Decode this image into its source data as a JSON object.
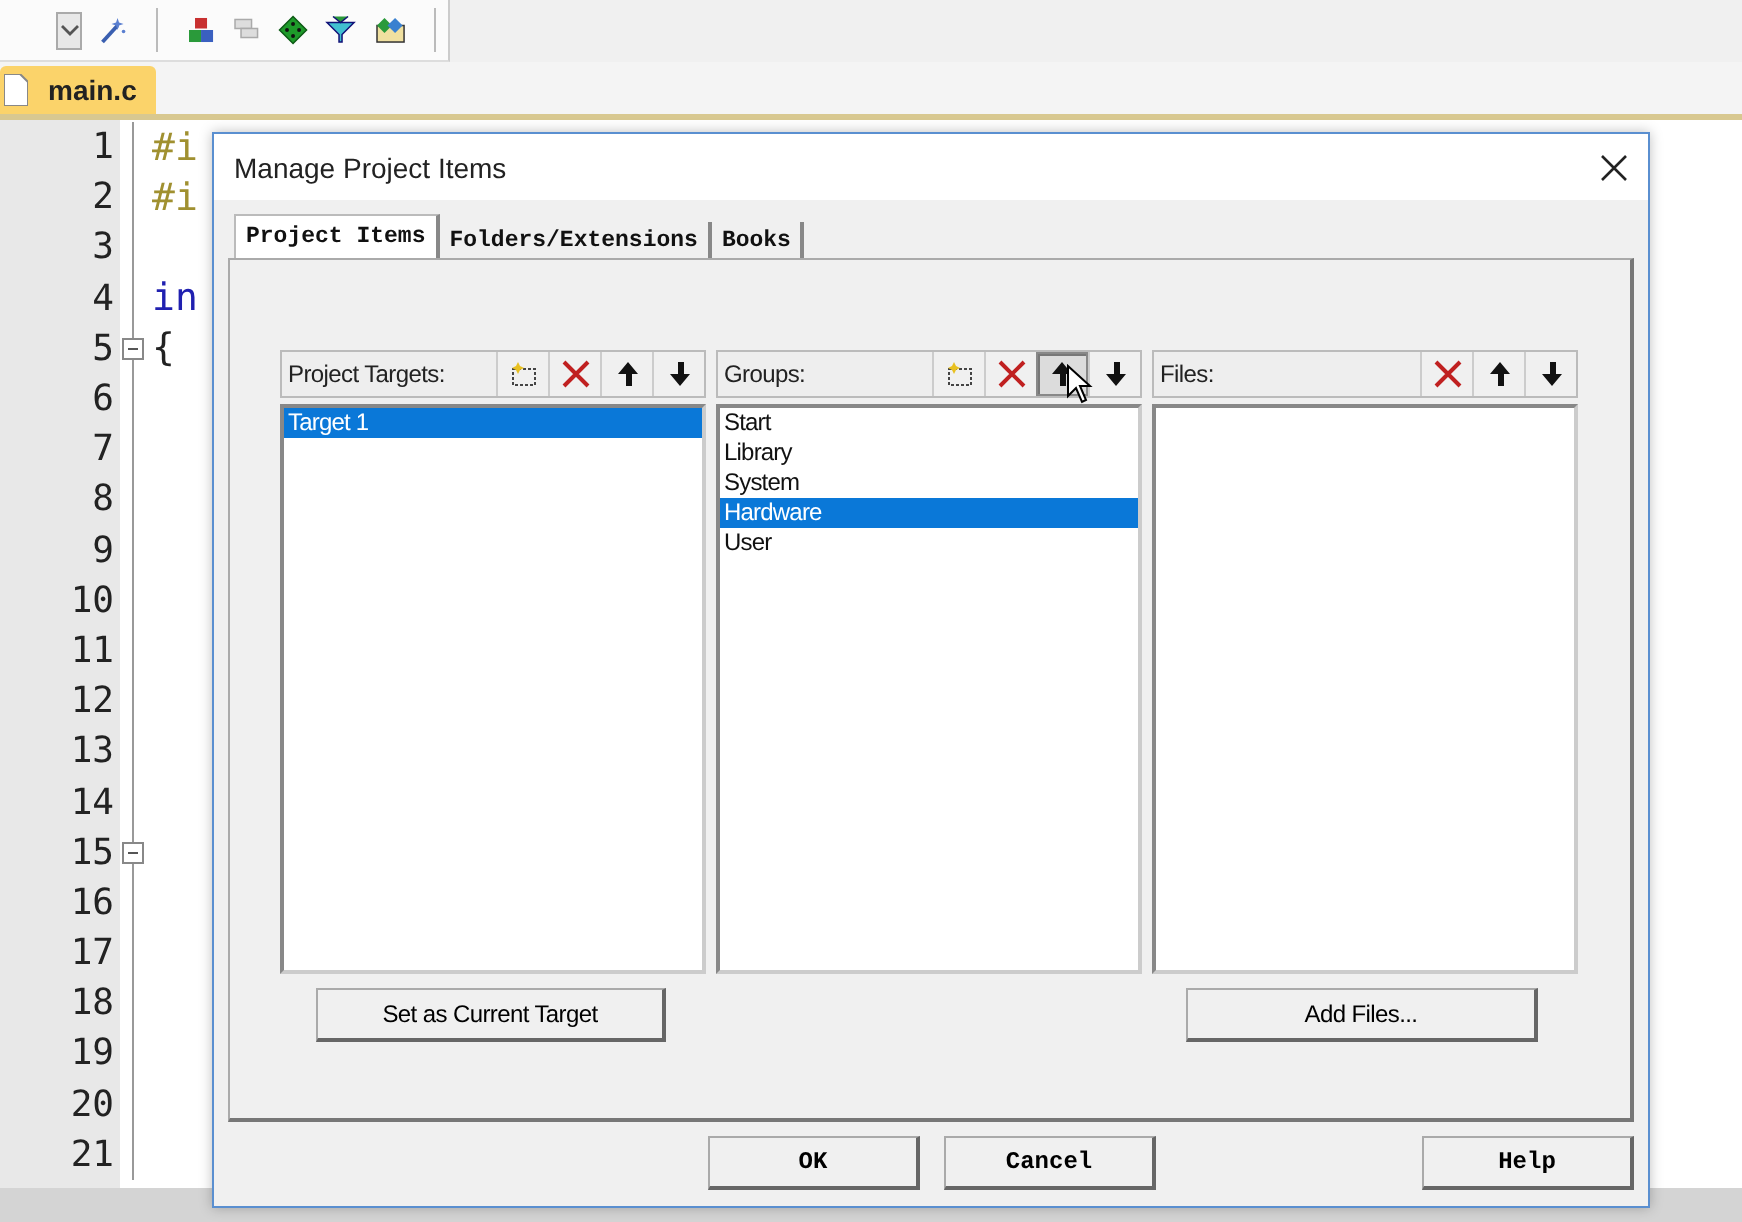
{
  "editor": {
    "tab": "main.c",
    "lines": [
      {
        "number": "1",
        "code": "#i",
        "kind": "directive",
        "fold": false
      },
      {
        "number": "2",
        "code": "#i",
        "kind": "directive",
        "fold": false
      },
      {
        "number": "3",
        "fold": false
      },
      {
        "number": "4",
        "code": "in",
        "kind": "keyword",
        "fold": false
      },
      {
        "number": "5",
        "code": "{",
        "kind": "plain",
        "fold": true
      },
      {
        "number": "6",
        "fold": false
      },
      {
        "number": "7",
        "fold": false
      },
      {
        "number": "8",
        "fold": false
      },
      {
        "number": "9",
        "fold": false
      },
      {
        "number": "10",
        "fold": false
      },
      {
        "number": "11",
        "fold": false
      },
      {
        "number": "12",
        "fold": false
      },
      {
        "number": "13",
        "fold": false
      },
      {
        "number": "14",
        "fold": false
      },
      {
        "number": "15",
        "fold": true
      },
      {
        "number": "16",
        "fold": false
      },
      {
        "number": "17",
        "fold": false
      },
      {
        "number": "18",
        "fold": false
      },
      {
        "number": "19",
        "fold": false
      },
      {
        "number": "20",
        "fold": false
      },
      {
        "number": "21",
        "fold": false
      }
    ]
  },
  "dialog": {
    "title": "Manage Project Items",
    "tabs": [
      {
        "label": "Project Items",
        "selected": true
      },
      {
        "label": "Folders/Extensions",
        "selected": false
      },
      {
        "label": "Books",
        "selected": false
      }
    ],
    "panels": [
      {
        "label": "Project Targets:",
        "tools": [
          {
            "kind": "new",
            "pressed": false
          },
          {
            "kind": "delete",
            "pressed": false
          },
          {
            "kind": "up",
            "pressed": false
          },
          {
            "kind": "down",
            "pressed": false
          }
        ],
        "items": [
          {
            "label": "Target 1",
            "selected": true
          }
        ],
        "action": "Set as Current Target"
      },
      {
        "label": "Groups:",
        "tools": [
          {
            "kind": "new",
            "pressed": false
          },
          {
            "kind": "delete",
            "pressed": false
          },
          {
            "kind": "up",
            "pressed": true
          },
          {
            "kind": "down",
            "pressed": false
          }
        ],
        "items": [
          {
            "label": "Start",
            "selected": false
          },
          {
            "label": "Library",
            "selected": false
          },
          {
            "label": "System",
            "selected": false
          },
          {
            "label": "Hardware",
            "selected": true
          },
          {
            "label": "User",
            "selected": false
          }
        ]
      },
      {
        "label": "Files:",
        "tools": [
          {
            "kind": "delete",
            "pressed": false
          },
          {
            "kind": "up",
            "pressed": false
          },
          {
            "kind": "down",
            "pressed": false
          }
        ],
        "action": "Add Files..."
      }
    ],
    "buttons": [
      "OK",
      "Cancel",
      "Help"
    ]
  }
}
